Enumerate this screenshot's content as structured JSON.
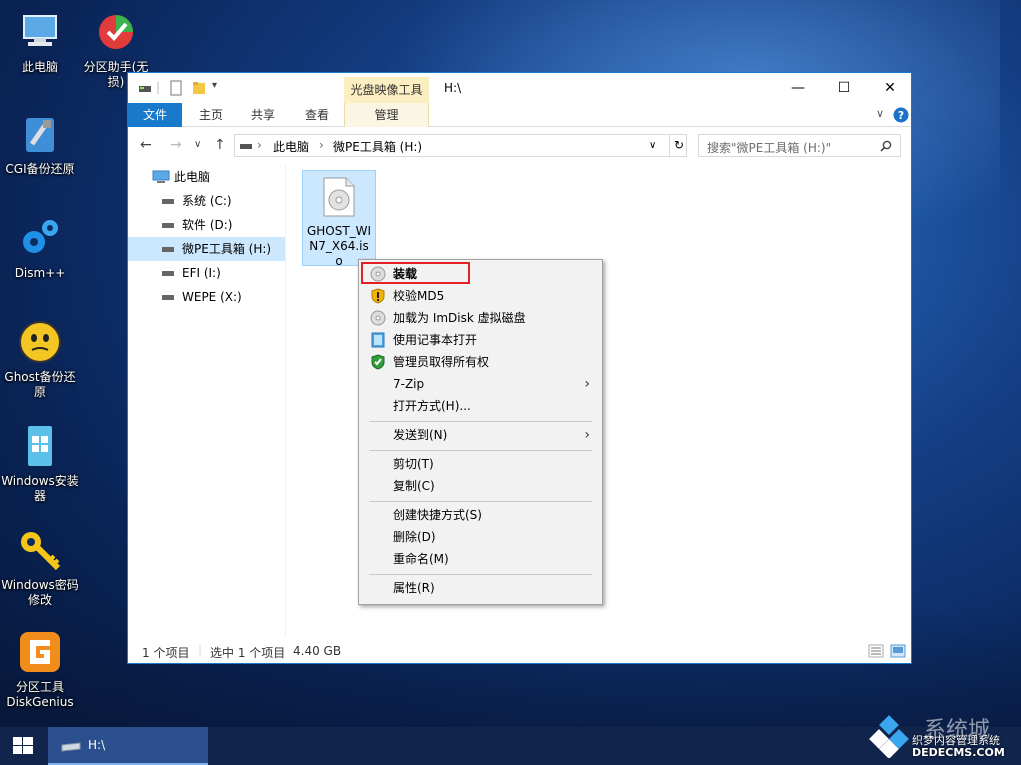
{
  "desktop": {
    "icons": [
      {
        "label": "此电脑"
      },
      {
        "label": "分区助手(无损)"
      },
      {
        "label": "CGI备份还原"
      },
      {
        "label": "Dism++"
      },
      {
        "label": "Ghost备份还原"
      },
      {
        "label": "Windows安装器"
      },
      {
        "label": "Windows密码修改"
      },
      {
        "label": "分区工具DiskGenius"
      }
    ]
  },
  "window": {
    "title": "H:\\",
    "context_tab": "光盘映像工具",
    "ribbon_tabs": [
      "文件",
      "主页",
      "共享",
      "查看",
      "管理"
    ],
    "window_buttons": {
      "minimize": "—",
      "maximize": "☐",
      "close": "✕"
    },
    "address": {
      "root": "此电脑",
      "current": "微PE工具箱 (H:)"
    },
    "search_placeholder": "搜索\"微PE工具箱 (H:)\"",
    "nav": [
      {
        "label": "此电脑"
      },
      {
        "label": "系统 (C:)"
      },
      {
        "label": "软件 (D:)"
      },
      {
        "label": "微PE工具箱 (H:)"
      },
      {
        "label": "EFI (I:)"
      },
      {
        "label": "WEPE (X:)"
      }
    ],
    "file": {
      "name": "GHOST_WIN7_X64.iso"
    },
    "status": {
      "count": "1 个项目",
      "selected": "选中 1 个项目",
      "size": "4.40 GB"
    }
  },
  "context_menu": {
    "items": [
      {
        "label": "装载",
        "bold": true
      },
      {
        "label": "校验MD5"
      },
      {
        "label": "加载为 ImDisk 虚拟磁盘"
      },
      {
        "label": "使用记事本打开"
      },
      {
        "label": "管理员取得所有权"
      },
      {
        "label": "7-Zip",
        "submenu": true
      },
      {
        "label": "打开方式(H)..."
      },
      {
        "label": "发送到(N)",
        "submenu": true
      },
      {
        "label": "剪切(T)"
      },
      {
        "label": "复制(C)"
      },
      {
        "label": "创建快捷方式(S)"
      },
      {
        "label": "删除(D)"
      },
      {
        "label": "重命名(M)"
      },
      {
        "label": "属性(R)"
      }
    ],
    "highlight_color": "#e32026"
  },
  "taskbar": {
    "active_item": "H:\\"
  },
  "watermark": {
    "line1": "系统城",
    "line2": "织梦内容管理系统",
    "line3": "DEDECMS.COM"
  }
}
